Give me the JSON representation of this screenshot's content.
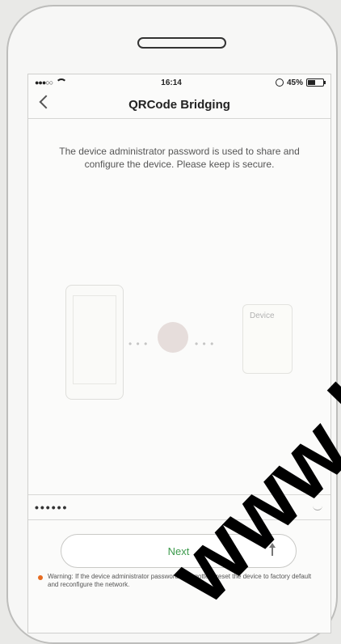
{
  "status_bar": {
    "time": "16:14",
    "battery": "45%"
  },
  "nav": {
    "title": "QRCode Bridging"
  },
  "description": "The device administrator password is used to share and configure the device. Please keep is secure.",
  "illustration": {
    "device_label": "Device"
  },
  "password": {
    "value": "••••••"
  },
  "buttons": {
    "next_label": "Next"
  },
  "warning": {
    "text": "Warning: If the device administrator password is forgotten, reset the device to factory default and reconfigure the network."
  },
  "watermark": {
    "text": "www.bezp"
  },
  "icons": {
    "back": "chevron-left-icon",
    "wifi": "wifi-icon",
    "battery": "battery-icon",
    "eye": "eye-icon",
    "arrow": "arrow-up-icon"
  },
  "colors": {
    "accent": "#3c9a4c",
    "warning": "#e66b20"
  }
}
